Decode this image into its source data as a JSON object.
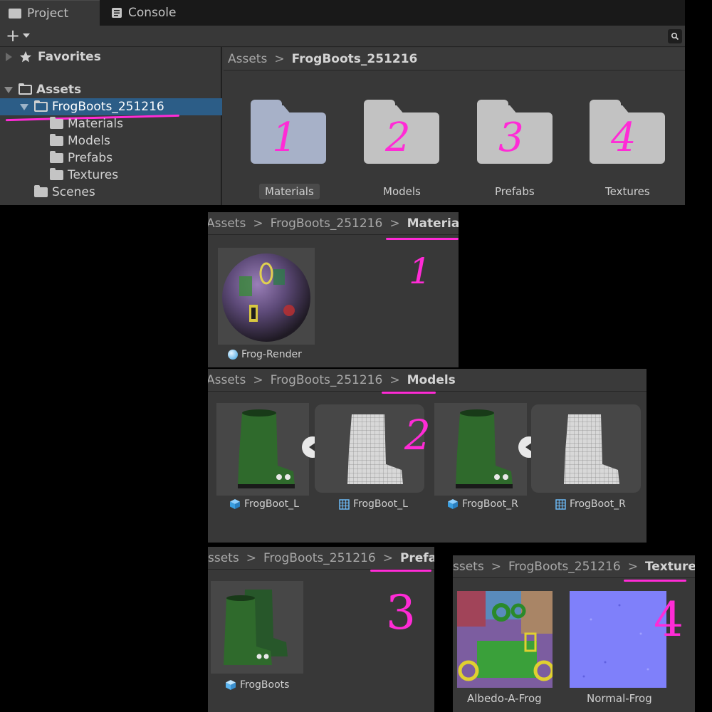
{
  "tabs": [
    {
      "label": "Project",
      "icon": "folder-icon"
    },
    {
      "label": "Console",
      "icon": "console-icon"
    }
  ],
  "toolbar": {
    "add_label": "+"
  },
  "tree": {
    "favorites": "Favorites",
    "assets": "Assets",
    "selected_folder": "FrogBoots_251216",
    "children": [
      "Materials",
      "Models",
      "Prefabs",
      "Textures"
    ],
    "scenes": "Scenes"
  },
  "breadcrumb_main": {
    "root": "Assets",
    "current": "FrogBoots_251216"
  },
  "folders": [
    {
      "label": "Materials",
      "number": "1"
    },
    {
      "label": "Models",
      "number": "2"
    },
    {
      "label": "Prefabs",
      "number": "3"
    },
    {
      "label": "Textures",
      "number": "4"
    }
  ],
  "materials_panel": {
    "crumb_root": "Assets",
    "crumb_mid": "FrogBoots_251216",
    "crumb_current": "Materials",
    "annotation": "1",
    "items": [
      {
        "label": "Frog-Render",
        "icon": "material-sphere-icon"
      }
    ]
  },
  "models_panel": {
    "crumb_root": "Assets",
    "crumb_mid": "FrogBoots_251216",
    "crumb_current": "Models",
    "annotation": "2",
    "items": [
      {
        "label": "FrogBoot_L",
        "icon": "model-cube-icon"
      },
      {
        "label": "FrogBoot_L",
        "icon": "mesh-grid-icon"
      },
      {
        "label": "FrogBoot_R",
        "icon": "model-cube-icon"
      },
      {
        "label": "FrogBoot_R",
        "icon": "mesh-grid-icon"
      }
    ]
  },
  "prefabs_panel": {
    "crumb_root": "ssets",
    "crumb_mid": "FrogBoots_251216",
    "crumb_current": "Prefabs",
    "annotation": "3",
    "items": [
      {
        "label": "FrogBoots",
        "icon": "prefab-cube-icon"
      }
    ]
  },
  "textures_panel": {
    "crumb_root": "ssets",
    "crumb_mid": "FrogBoots_251216",
    "crumb_current": "Textures",
    "annotation": "4",
    "items": [
      {
        "label": "Albedo-A-Frog",
        "icon": "texture-albedo-icon"
      },
      {
        "label": "Normal-Frog",
        "icon": "texture-normal-icon"
      }
    ]
  },
  "colors": {
    "accent_annotation": "#ff2bd6",
    "selection": "#2c5d87"
  }
}
